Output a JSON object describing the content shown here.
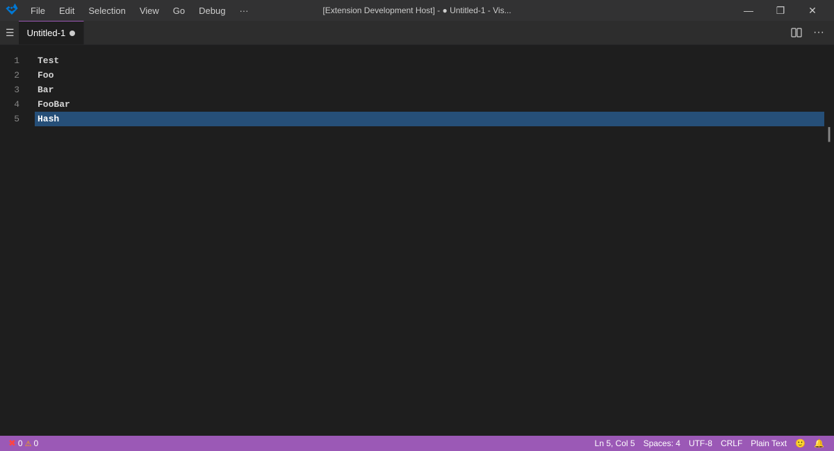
{
  "titleBar": {
    "appName": "Visual Studio Code",
    "title": "[Extension Development Host] - ● Untitled-1 - Vis...",
    "menuItems": [
      "File",
      "Edit",
      "Selection",
      "View",
      "Go",
      "Debug",
      "···"
    ],
    "controls": {
      "minimize": "—",
      "maximize": "❐",
      "close": "✕"
    }
  },
  "tabBar": {
    "tabs": [
      {
        "label": "Untitled-1",
        "modified": true,
        "active": true
      }
    ],
    "actions": {
      "splitEditor": "⊟",
      "more": "···"
    }
  },
  "editor": {
    "lines": [
      {
        "number": "1",
        "text": "Test",
        "selected": false
      },
      {
        "number": "2",
        "text": "Foo",
        "selected": false
      },
      {
        "number": "3",
        "text": "Bar",
        "selected": false
      },
      {
        "number": "4",
        "text": "FooBar",
        "selected": false
      },
      {
        "number": "5",
        "text": "Hash",
        "selected": true
      }
    ]
  },
  "statusBar": {
    "left": {
      "errors": "0",
      "warnings": "0"
    },
    "right": {
      "position": "Ln 5, Col 5",
      "spaces": "Spaces: 4",
      "encoding": "UTF-8",
      "lineEnding": "CRLF",
      "language": "Plain Text",
      "smiley": "🙂",
      "bell": "🔔"
    }
  }
}
